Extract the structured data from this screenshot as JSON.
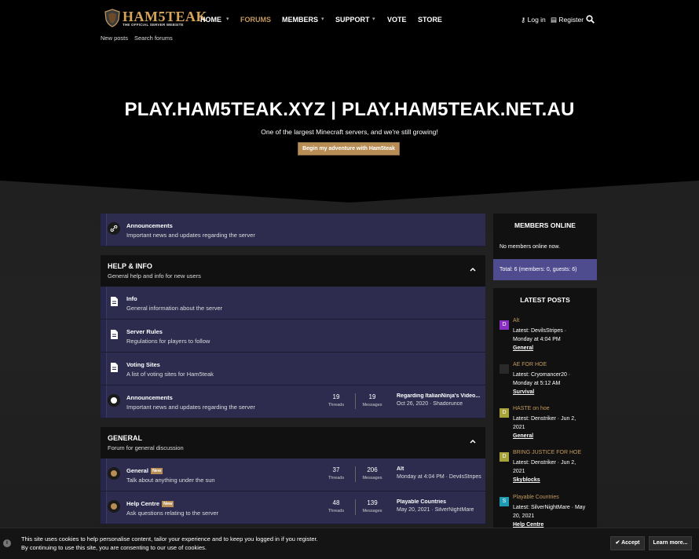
{
  "header": {
    "logo_brand": "HAM5TEAK",
    "logo_tagline": "THE OFFICIAL SERVER WEBSITE",
    "nav": [
      {
        "label": "HOME",
        "dropdown": true
      },
      {
        "label": "FORUMS",
        "dropdown": false,
        "active": true
      },
      {
        "label": "MEMBERS",
        "dropdown": true
      },
      {
        "label": "SUPPORT",
        "dropdown": true
      },
      {
        "label": "VOTE",
        "dropdown": false
      },
      {
        "label": "STORE",
        "dropdown": false
      }
    ],
    "login_label": "Log in",
    "register_label": "Register",
    "subnav": [
      "New posts",
      "Search forums"
    ]
  },
  "hero": {
    "title": "PLAY.HAM5TEAK.XYZ | PLAY.HAM5TEAK.NET.AU",
    "subtitle": "One of the largest Minecraft servers, and we're still growing!",
    "button_label": "Begin my adventure with Ham5teak"
  },
  "top_node": {
    "title": "Announcements",
    "desc": "Important news and updates regarding the server"
  },
  "categories": [
    {
      "title": "HELP & INFO",
      "desc": "General help and info for new users",
      "nodes": [
        {
          "title": "Info",
          "desc": "General information about the server"
        },
        {
          "title": "Server Rules",
          "desc": "Regulations for players to follow"
        },
        {
          "title": "Voting Sites",
          "desc": "A list of voting sites for Ham5teak"
        },
        {
          "title": "Announcements",
          "desc": "Important news and updates regarding the server",
          "threads": "19",
          "messages": "19",
          "latest_title": "Regarding ItalianNinja's Video...",
          "latest_meta": "Oct 26, 2020 · Shadorunce"
        }
      ]
    },
    {
      "title": "GENERAL",
      "desc": "Forum for general discussion",
      "nodes": [
        {
          "title": "General",
          "new": "New",
          "desc": "Talk about anything under the sun",
          "threads": "37",
          "messages": "206",
          "latest_title": "Alt",
          "latest_meta": "Monday at 4:04 PM · DevilsStripes"
        },
        {
          "title": "Help Centre",
          "new": "New",
          "desc": "Ask questions relating to the server",
          "threads": "48",
          "messages": "139",
          "latest_title": "Playable Countries",
          "latest_meta": "May 20, 2021 · SilverNightMare"
        }
      ]
    }
  ],
  "stat_labels": {
    "threads": "Threads",
    "messages": "Messages"
  },
  "sidebar": {
    "members_online": {
      "title": "MEMBERS ONLINE",
      "empty": "No members online now.",
      "total": "Total: 6 (members: 0, guests: 6)"
    },
    "latest_posts": {
      "title": "LATEST POSTS",
      "posts": [
        {
          "avatar": "D",
          "avatar_color": "#8a2fc4",
          "title": "Alt",
          "line1": "Latest: DevilsStripes ·",
          "line2": "Monday at 4:04 PM",
          "forum": "General"
        },
        {
          "avatar": "",
          "avatar_color": "#2a2a2a",
          "title": "AE FOR HOE",
          "line1": "Latest: Cryomancer20 ·",
          "line2": "Monday at 5:12 AM",
          "forum": "Survival"
        },
        {
          "avatar": "D",
          "avatar_color": "#a8a23a",
          "title": "HASTE on hoe",
          "line1": "Latest: Denstriker · Jun 2,",
          "line2": "2021",
          "forum": "General"
        },
        {
          "avatar": "D",
          "avatar_color": "#a8a23a",
          "title": "BRING JUSTICE FOR HOE",
          "line1": "Latest: Denstriker · Jun 2,",
          "line2": "2021",
          "forum": "Skyblocks"
        },
        {
          "avatar": "S",
          "avatar_color": "#1e9bb3",
          "title": "Playable Countries",
          "line1": "Latest: SilverNightMare · May",
          "line2": "20, 2021",
          "forum": "Help Centre"
        }
      ]
    }
  },
  "cookie": {
    "line1": "This site uses cookies to help personalise content, tailor your experience and to keep you logged in if you register.",
    "line2": "By continuing to use this site, you are consenting to our use of cookies.",
    "accept_label": "Accept",
    "learn_label": "Learn more..."
  },
  "colors": {
    "accent": "#b78d55",
    "node_bg": "#2d2c4f",
    "total_bg": "#4e4c8f"
  }
}
